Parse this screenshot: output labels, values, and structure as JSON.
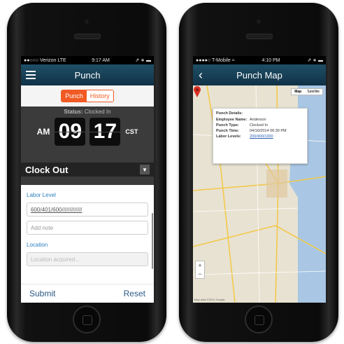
{
  "left_phone": {
    "status_bar": {
      "carrier": "●●○○○ Verizon  LTE",
      "time": "9:17 AM",
      "right": "⇗ ∗ ▬"
    },
    "nav": {
      "title": "Punch",
      "menu_icon": "hamburger-icon"
    },
    "tabs": [
      {
        "label": "Punch",
        "active": true
      },
      {
        "label": "History",
        "active": false
      }
    ],
    "clock": {
      "status_label": "Status:",
      "status_value": "Clocked In",
      "ampm": "AM",
      "hour": "09",
      "minute": "17",
      "timezone": "CST"
    },
    "action_select": {
      "value": "Clock Out",
      "icon": "chevron-down-icon"
    },
    "form": {
      "labor_label": "Labor Level",
      "labor_value": "600/401/600/////////////",
      "note_placeholder": "Add note",
      "location_label": "Location",
      "location_placeholder": "Location acquired..."
    },
    "bottom": {
      "submit": "Submit",
      "reset": "Reset"
    }
  },
  "right_phone": {
    "status_bar": {
      "carrier": "●●●●○ T-Mobile  ≈",
      "time": "4:10 PM",
      "right": "⇗ ∗ ▬"
    },
    "nav": {
      "title": "Punch Map",
      "back_icon": "chevron-left-icon"
    },
    "map": {
      "toggle": [
        {
          "label": "Map",
          "active": true
        },
        {
          "label": "Satellite",
          "active": false
        }
      ],
      "info": {
        "heading": "Punch Details:",
        "rows": [
          {
            "key": "Employee Name:",
            "value": "Anderson"
          },
          {
            "key": "Punch Type:",
            "value": "Clocked In"
          },
          {
            "key": "Punch Time:",
            "value": "04/16/2014 06:30 PM"
          },
          {
            "key": "Labor Levels:",
            "value": "200/400/1000"
          }
        ]
      },
      "zoom_in": "+",
      "zoom_out": "−",
      "pin_icon": "map-pin-icon",
      "attribution": "Map data ©2014 Google"
    }
  },
  "colors": {
    "accent": "#f15a24",
    "nav": "#1a4761",
    "link": "#2a7fbf"
  }
}
